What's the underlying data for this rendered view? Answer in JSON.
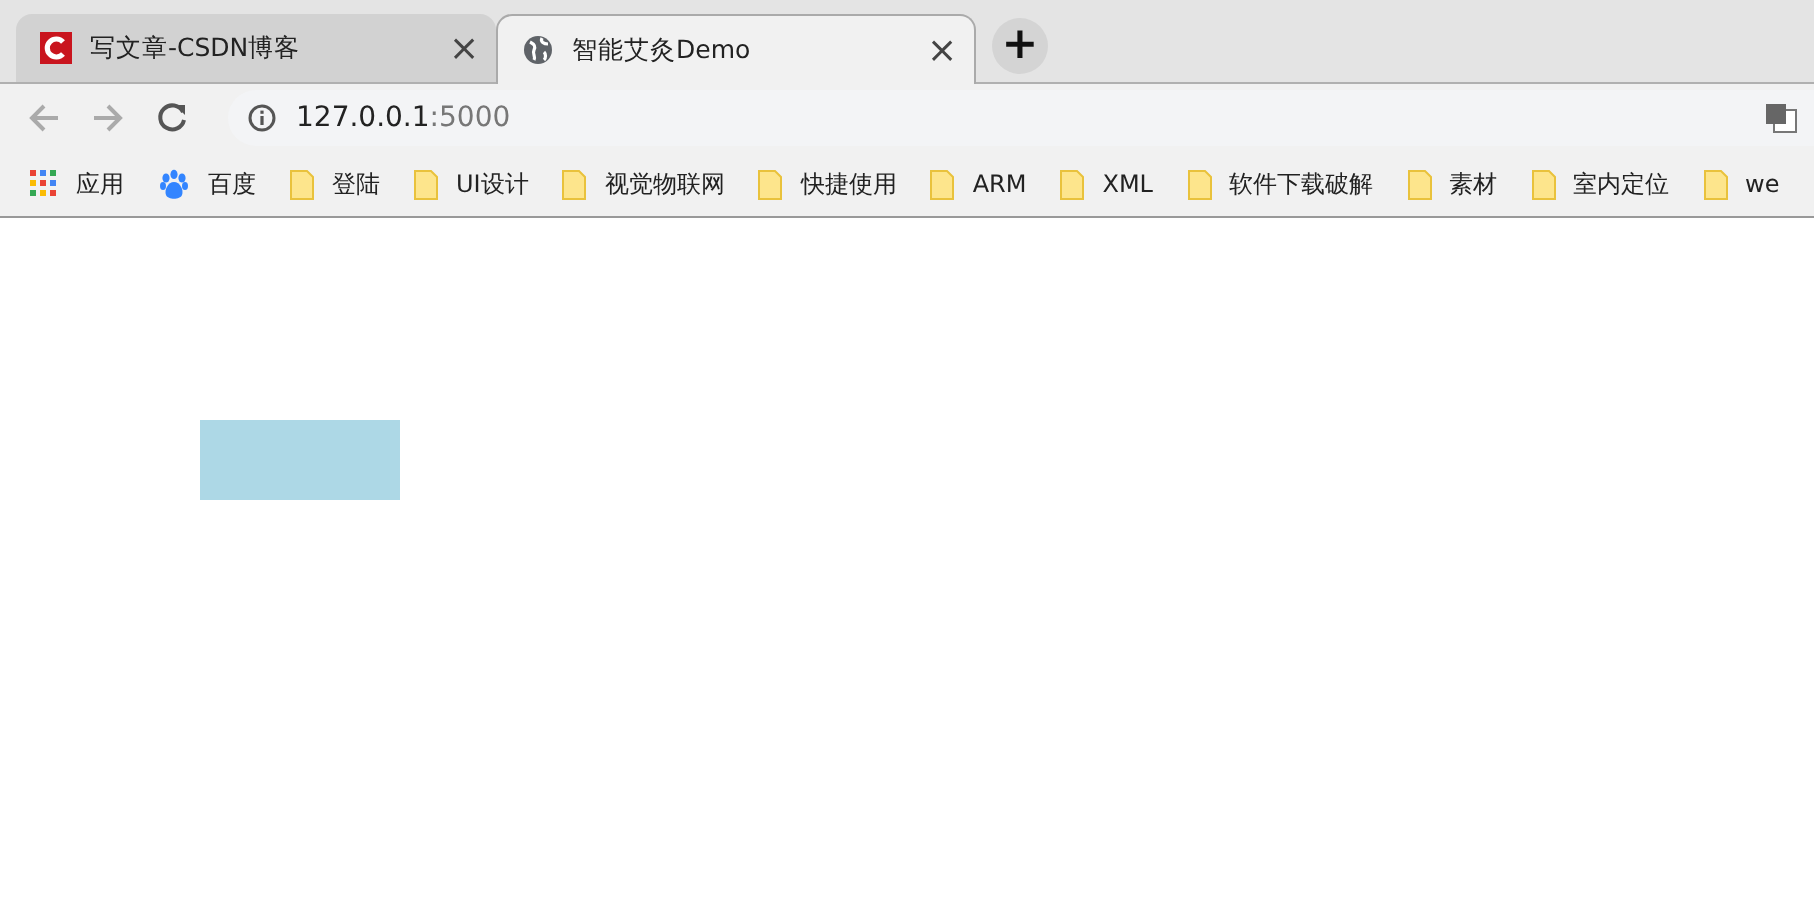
{
  "tabs": [
    {
      "title": "写文章-CSDN博客",
      "kind": "csdn",
      "selected": false,
      "close": "×"
    },
    {
      "title": "智能艾灸Demo",
      "kind": "globe",
      "selected": true,
      "close": "×"
    }
  ],
  "new_tab": "+",
  "address_bar": {
    "host": "127.0.0.1",
    "port": ":5000"
  },
  "bookmarks": [
    {
      "label": "应用",
      "kind": "apps"
    },
    {
      "label": "百度",
      "kind": "paw"
    },
    {
      "label": "登陆",
      "kind": "folder"
    },
    {
      "label": "UI设计",
      "kind": "folder"
    },
    {
      "label": "视觉物联网",
      "kind": "folder"
    },
    {
      "label": "快捷使用",
      "kind": "folder"
    },
    {
      "label": "ARM",
      "kind": "folder"
    },
    {
      "label": "XML",
      "kind": "folder"
    },
    {
      "label": "软件下载破解",
      "kind": "folder"
    },
    {
      "label": "素材",
      "kind": "folder"
    },
    {
      "label": "室内定位",
      "kind": "folder"
    },
    {
      "label": "we",
      "kind": "folder"
    }
  ]
}
